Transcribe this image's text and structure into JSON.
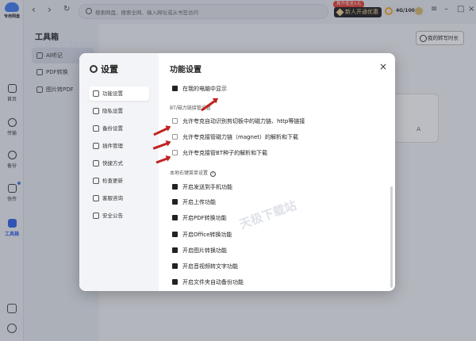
{
  "app": {
    "name": "专用网盘"
  },
  "rail": {
    "items": [
      {
        "label": "首页"
      },
      {
        "label": "传输"
      },
      {
        "label": "备份"
      },
      {
        "label": "快传"
      },
      {
        "label": "工具箱"
      }
    ]
  },
  "search": {
    "placeholder": "搜索网盘、搜索全网、输入网址或从书签访问"
  },
  "vip": {
    "badge": "首开低至1元",
    "label": "新人开通优惠"
  },
  "storage": {
    "text": "4G/100"
  },
  "toolbox": {
    "title": "工具箱",
    "items": [
      {
        "label": "AI听记"
      },
      {
        "label": "PDF转换"
      },
      {
        "label": "图片转PDF"
      }
    ],
    "transfer_btn": "我的转写时长"
  },
  "settings": {
    "title": "设置",
    "nav": [
      {
        "label": "功能设置"
      },
      {
        "label": "隐私设置"
      },
      {
        "label": "备份设置"
      },
      {
        "label": "插件管理"
      },
      {
        "label": "快捷方式"
      },
      {
        "label": "检查更新"
      },
      {
        "label": "客服咨询"
      },
      {
        "label": "安全公告"
      }
    ],
    "panel_title": "功能设置",
    "option_pc": "在我的电脑中显示",
    "bt_section": "BT/磁力链接管设置",
    "bt_options": [
      {
        "label": "允许夸克自动识别剪切板中的磁力链、http等链接",
        "checked": false
      },
      {
        "label": "允许夸克接管磁力链（magnet）的解析和下载",
        "checked": false
      },
      {
        "label": "允许夸克接管BT种子的解析和下载",
        "checked": false
      }
    ],
    "menu_section": "本地右键菜单设置",
    "menu_options": [
      {
        "label": "开启发送到手机功能"
      },
      {
        "label": "开启上传功能"
      },
      {
        "label": "开启PDF转换功能"
      },
      {
        "label": "开启Office转换功能"
      },
      {
        "label": "开启图片转换功能"
      },
      {
        "label": "开启音视频转文字功能"
      },
      {
        "label": "开启文件夹自动备份功能"
      }
    ]
  },
  "watermark": "天极下载站"
}
